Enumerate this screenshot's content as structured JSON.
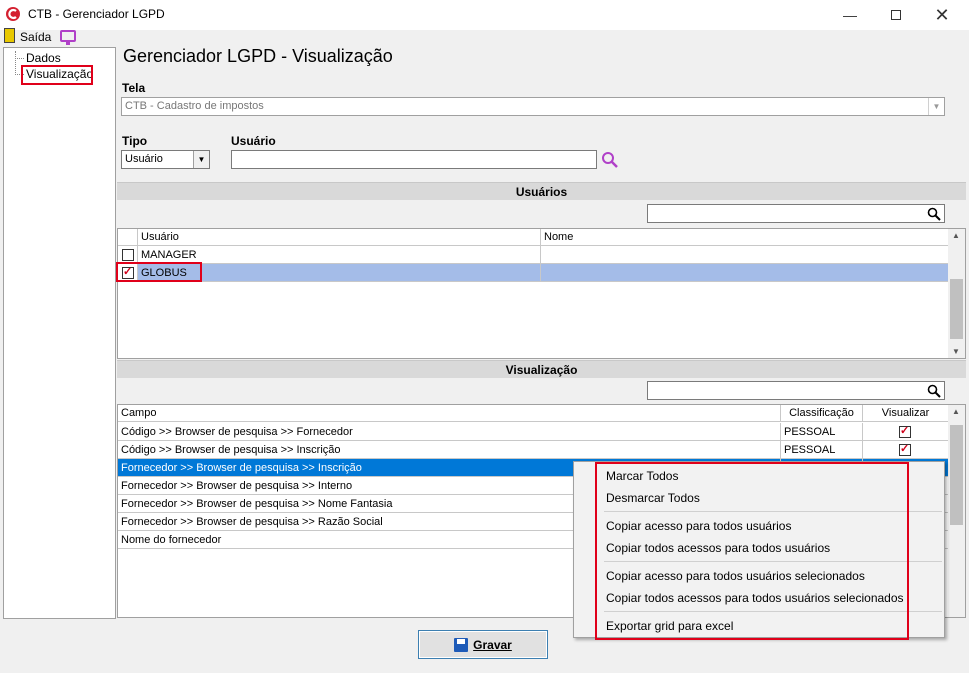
{
  "window": {
    "title": "CTB - Gerenciador LGPD",
    "min_icon": "minimize-icon",
    "max_icon": "maximize-icon",
    "close_icon": "close-icon"
  },
  "menu": {
    "exit_label": "Saída"
  },
  "tree": {
    "items": [
      "Dados",
      "Visualização"
    ]
  },
  "main": {
    "heading": "Gerenciador LGPD - Visualização",
    "tela_label": "Tela",
    "tela_value": "CTB - Cadastro de impostos",
    "tipo_label": "Tipo",
    "tipo_value": "Usuário",
    "usuario_label": "Usuário",
    "usuario_value": ""
  },
  "users_section": {
    "title": "Usuários",
    "columns": [
      "Usuário",
      "Nome"
    ],
    "rows": [
      {
        "usuario": "MANAGER",
        "nome": "",
        "checked": false
      },
      {
        "usuario": "GLOBUS",
        "nome": "",
        "checked": true
      }
    ]
  },
  "vis_section": {
    "title": "Visualização",
    "columns": [
      "Campo",
      "Classificação",
      "Visualizar"
    ],
    "rows": [
      {
        "campo": "Código >> Browser de pesquisa >> Fornecedor",
        "classificacao": "PESSOAL",
        "visualizar": true
      },
      {
        "campo": "Código >> Browser de pesquisa >> Inscrição",
        "classificacao": "PESSOAL",
        "visualizar": true
      },
      {
        "campo": "Fornecedor >> Browser de pesquisa >> Inscrição",
        "classificacao": "",
        "visualizar": null
      },
      {
        "campo": "Fornecedor >> Browser de pesquisa >> Interno",
        "classificacao": "",
        "visualizar": null
      },
      {
        "campo": "Fornecedor >> Browser de pesquisa >> Nome Fantasia",
        "classificacao": "",
        "visualizar": null
      },
      {
        "campo": "Fornecedor >> Browser de pesquisa >> Razão Social",
        "classificacao": "",
        "visualizar": null
      },
      {
        "campo": "Nome do fornecedor",
        "classificacao": "",
        "visualizar": null
      }
    ]
  },
  "context_menu": {
    "items": [
      "Marcar Todos",
      "Desmarcar Todos",
      "Copiar acesso para todos usuários",
      "Copiar todos acessos para todos usuários",
      "Copiar acesso para todos usuários selecionados",
      "Copiar todos acessos para todos usuários selecionados",
      "Exportar grid para excel"
    ]
  },
  "buttons": {
    "gravar": "Gravar"
  },
  "colors": {
    "selection": "#0078d7",
    "row_highlight": "#a4bce8",
    "annotation": "#e0001a"
  }
}
